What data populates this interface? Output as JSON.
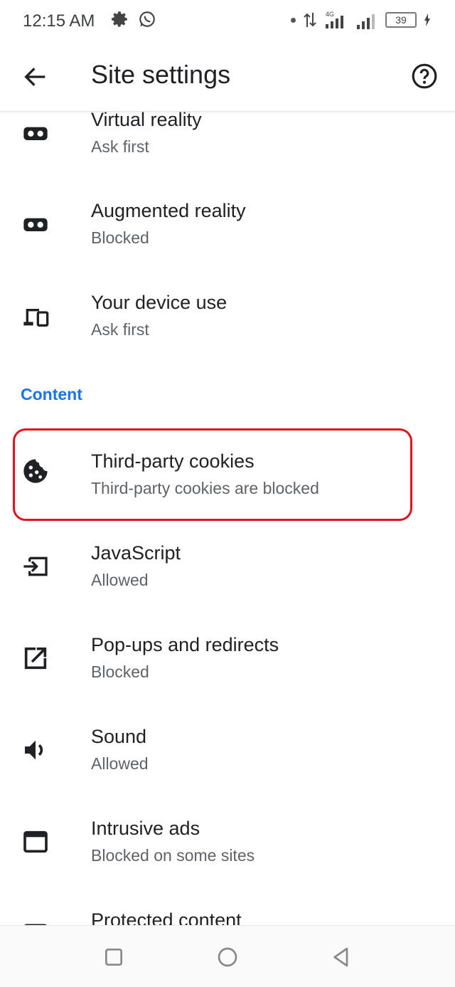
{
  "status_bar": {
    "time": "12:15 AM",
    "battery": "39",
    "icons": [
      "gear-icon",
      "whatsapp-icon",
      "data-arrows-icon",
      "signal-4g-icon",
      "signal-icon",
      "battery-icon",
      "charging-icon"
    ]
  },
  "app_bar": {
    "title": "Site settings",
    "back_icon": "back-arrow-icon",
    "help_icon": "help-icon"
  },
  "section_label": "Content",
  "items": [
    {
      "title": "Virtual reality",
      "subtitle": "Ask first",
      "icon": "vr-headset-icon"
    },
    {
      "title": "Augmented reality",
      "subtitle": "Blocked",
      "icon": "ar-headset-icon"
    },
    {
      "title": "Your device use",
      "subtitle": "Ask first",
      "icon": "devices-icon"
    },
    {
      "title": "Third-party cookies",
      "subtitle": "Third-party cookies are blocked",
      "icon": "cookie-icon"
    },
    {
      "title": "JavaScript",
      "subtitle": "Allowed",
      "icon": "javascript-icon"
    },
    {
      "title": "Pop-ups and redirects",
      "subtitle": "Blocked",
      "icon": "popup-icon"
    },
    {
      "title": "Sound",
      "subtitle": "Allowed",
      "icon": "sound-icon"
    },
    {
      "title": "Intrusive ads",
      "subtitle": "Blocked on some sites",
      "icon": "ads-icon"
    },
    {
      "title": "Protected content",
      "subtitle": "",
      "icon": "protected-content-icon"
    }
  ],
  "nav_bar": [
    "recents-button",
    "home-button",
    "back-button"
  ],
  "colors": {
    "accent": "#1a73e8",
    "highlight": "#e0141e"
  }
}
